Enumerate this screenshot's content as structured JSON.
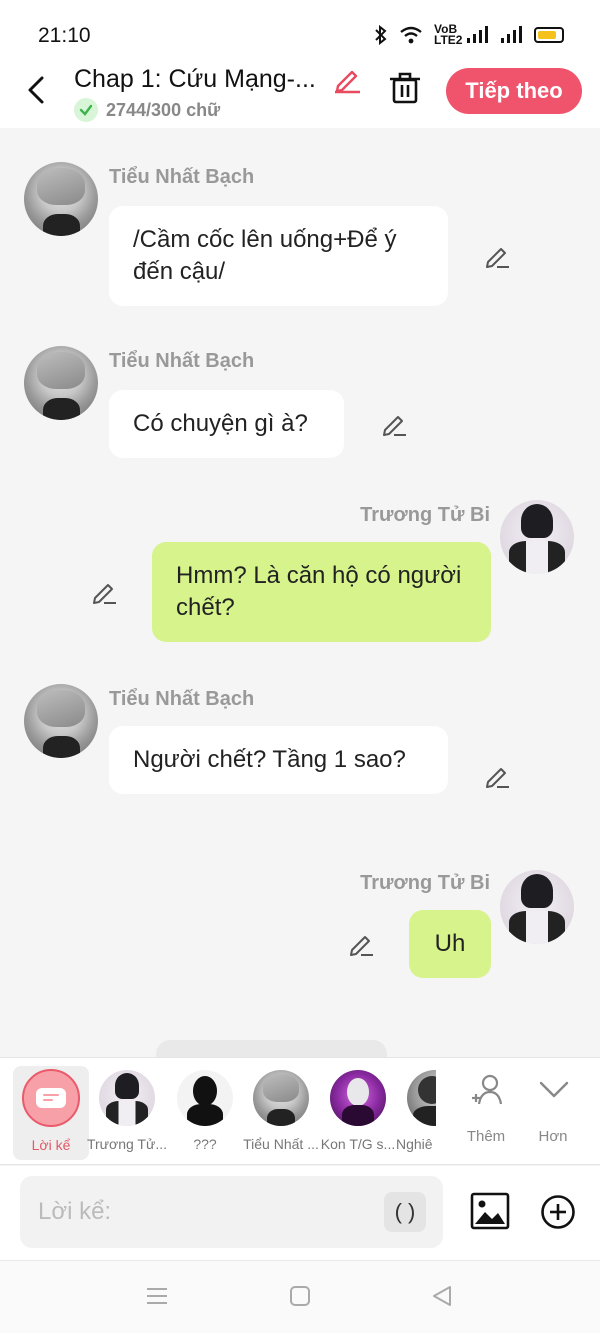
{
  "status_bar": {
    "time": "21:10",
    "net_label_top": "VoB",
    "net_label_bottom": "LTE2",
    "colors": {
      "battery": "#f4c21a"
    }
  },
  "header": {
    "title": "Chap 1: Cứu Mạng-...",
    "word_count": "2744/300 chữ",
    "next_label": "Tiếp theo",
    "colors": {
      "next_button": "#f0546c",
      "title_edit_icon": "#e84a5f",
      "check": "#3cb44b"
    }
  },
  "messages": [
    {
      "side": "left",
      "sender": "Tiểu Nhất Bạch",
      "text": "/Cầm cốc lên uống+Để ý đến cậu/"
    },
    {
      "side": "left",
      "sender": "Tiểu Nhất Bạch",
      "text": "Có chuyện gì à?"
    },
    {
      "side": "right",
      "sender": "Trương Tử Bi",
      "text": "Hmm? Là căn hộ có người chết?"
    },
    {
      "side": "left",
      "sender": "Tiểu Nhất Bạch",
      "text": "Người chết? Tầng 1 sao?"
    },
    {
      "side": "right",
      "sender": "Trương Tử Bi",
      "text": "Uh"
    }
  ],
  "bubble_colors": {
    "left": "#ffffff",
    "right": "#d6f38c"
  },
  "character_bar": {
    "narrator_label": "Lời kể",
    "characters": [
      {
        "label": "Trương Tử..."
      },
      {
        "label": "???"
      },
      {
        "label": "Tiểu Nhất ..."
      },
      {
        "label": "Kon T/G s..."
      },
      {
        "label": "Nghiê"
      }
    ],
    "more_label": "Thêm",
    "collapse_label": "Hơn"
  },
  "input": {
    "placeholder": "Lời kể:",
    "paren_label": "( )"
  },
  "icons": [
    "back-icon",
    "pencil-icon",
    "check-icon",
    "trash-icon",
    "bluetooth-icon",
    "wifi-icon",
    "signal-icon",
    "battery-icon",
    "add-person-icon",
    "chevron-down-icon",
    "image-icon",
    "plus-circle-icon",
    "nav-menu-icon",
    "nav-home-icon",
    "nav-back-icon",
    "narrator-icon"
  ]
}
